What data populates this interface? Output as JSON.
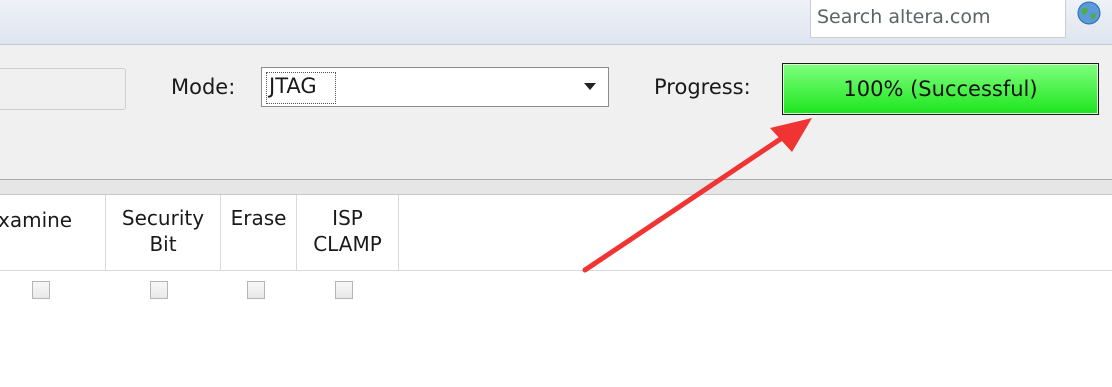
{
  "search": {
    "placeholder": "Search altera.com"
  },
  "toolbar": {
    "mode_label": "Mode:",
    "mode_value": "JTAG",
    "progress_label": "Progress:",
    "progress_value": 1.0,
    "progress_text": "100% (Successful)"
  },
  "table": {
    "columns": [
      {
        "label": "xamine"
      },
      {
        "label": "Security\nBit"
      },
      {
        "label": "Erase"
      },
      {
        "label": "ISP\nCLAMP"
      }
    ],
    "row": {
      "examine": false,
      "security_bit": false,
      "erase": false,
      "isp_clamp": false
    }
  },
  "colors": {
    "progress_fill": "#2bea2b",
    "annotation_arrow": "#f03434"
  },
  "icons": {
    "globe": "globe-icon",
    "dropdown": "chevron-down-icon"
  }
}
